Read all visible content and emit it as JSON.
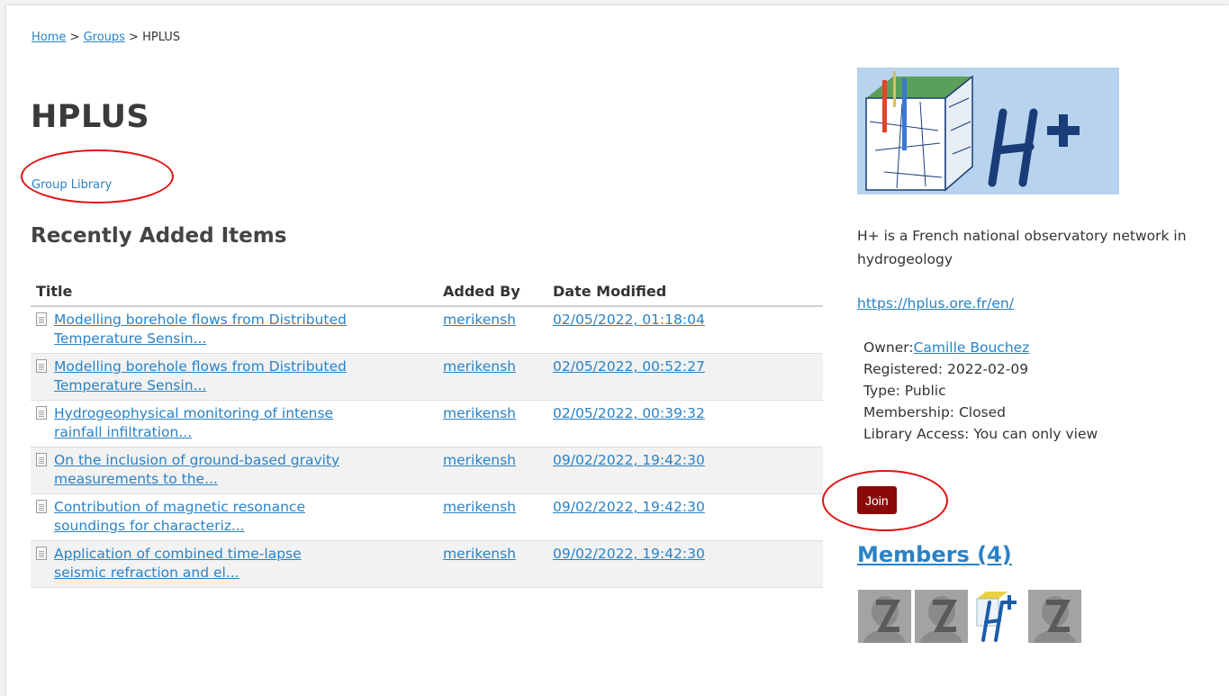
{
  "breadcrumb": {
    "home": "Home",
    "sep1": " > ",
    "groups": "Groups",
    "sep2": " > ",
    "current": "HPLUS"
  },
  "page_title": "HPLUS",
  "group_library_link": "Group Library",
  "recent": {
    "heading": "Recently Added Items",
    "columns": [
      "Title",
      "Added By",
      "Date Modified"
    ],
    "rows": [
      {
        "title_line1": "Modelling borehole flows from Distributed",
        "title_line2": "Temperature Sensin...",
        "added_by": "merikensh",
        "date": "02/05/2022, 01:18:04"
      },
      {
        "title_line1": "Modelling borehole flows from Distributed",
        "title_line2": "Temperature Sensin...",
        "added_by": "merikensh",
        "date": "02/05/2022, 00:52:27"
      },
      {
        "title_line1": "Hydrogeophysical monitoring of intense",
        "title_line2": "rainfall infiltration...",
        "added_by": "merikensh",
        "date": "02/05/2022, 00:39:32"
      },
      {
        "title_line1": "On the inclusion of ground-based gravity",
        "title_line2": "measurements to the...",
        "added_by": "merikensh",
        "date": "09/02/2022, 19:42:30"
      },
      {
        "title_line1": "Contribution of magnetic resonance",
        "title_line2": "soundings for characteriz...",
        "added_by": "merikensh",
        "date": "09/02/2022, 19:42:30"
      },
      {
        "title_line1": "Application of combined time-lapse",
        "title_line2": "seismic refraction and el...",
        "added_by": "merikensh",
        "date": "09/02/2022, 19:42:30"
      }
    ]
  },
  "sidebar": {
    "description": "H+ is a French national observatory network in hydrogeology",
    "website": "https://hplus.ore.fr/en/",
    "owner_label": "Owner:",
    "owner_name": "Camille Bouchez",
    "registered": "Registered: 2022-02-09",
    "type": "Type: Public",
    "membership": "Membership: Closed",
    "library_access": "Library Access: You can only view",
    "join_label": "Join",
    "members_heading": "Members (4)"
  },
  "colors": {
    "link": "#2a82c6",
    "join_button": "#8a0a0a",
    "annotation": "#e01010",
    "logo_background": "#b7d3ee",
    "logo_text": "#1a3c78"
  },
  "icons": {
    "item_type": "document-icon",
    "member_default": "user-placeholder-icon"
  }
}
